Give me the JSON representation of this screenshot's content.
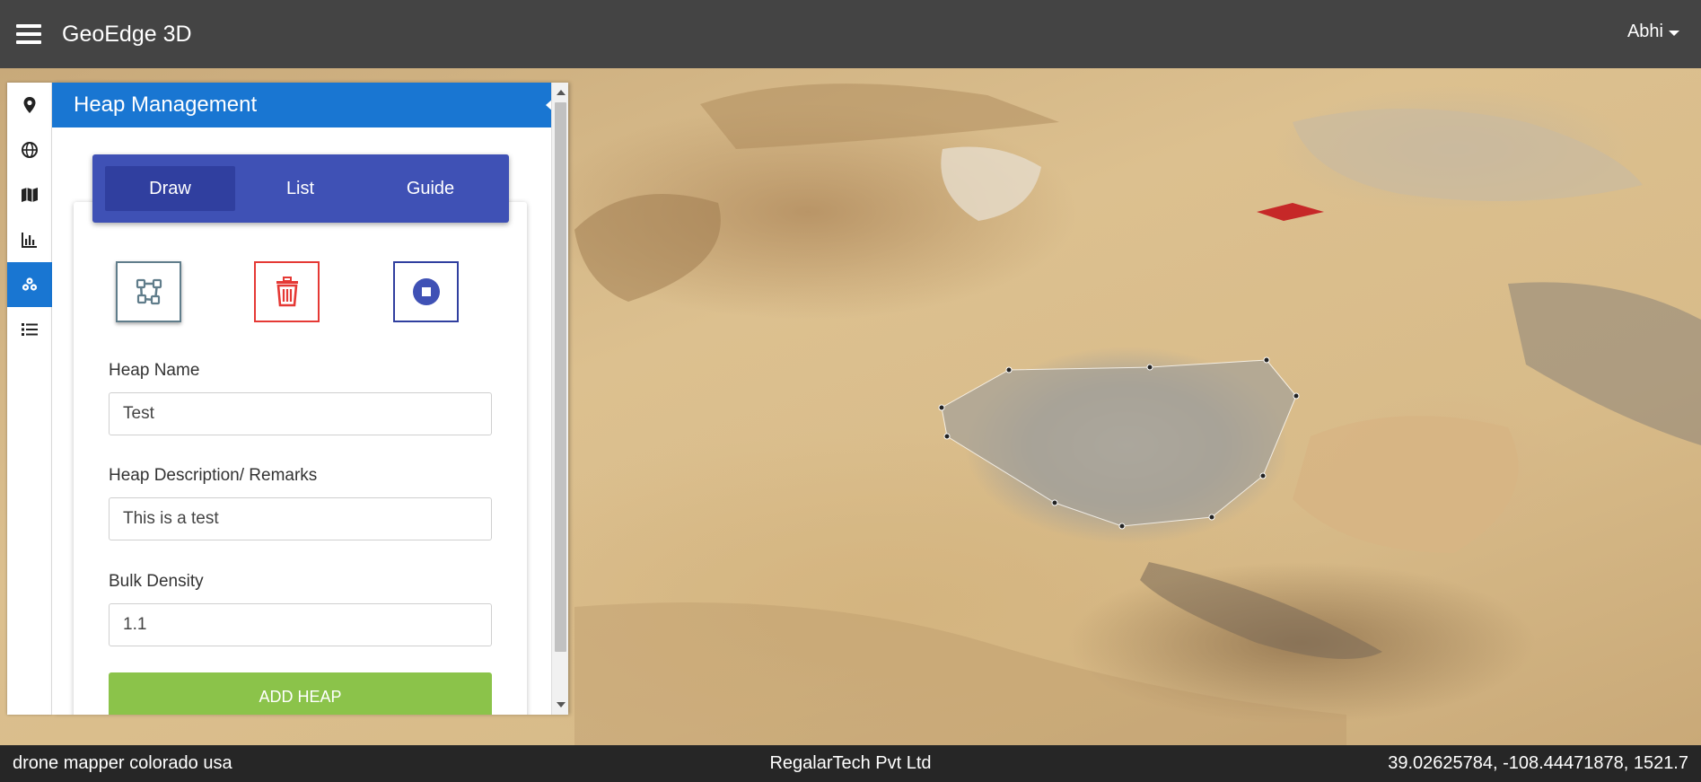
{
  "app": {
    "title": "GeoEdge 3D"
  },
  "user": {
    "name": "Abhi"
  },
  "panel": {
    "title": "Heap Management",
    "tabs": [
      {
        "label": "Draw",
        "active": true
      },
      {
        "label": "List",
        "active": false
      },
      {
        "label": "Guide",
        "active": false
      }
    ],
    "tools": [
      {
        "icon": "polygon-draw-icon"
      },
      {
        "icon": "trash-icon"
      },
      {
        "icon": "stop-circle-icon"
      }
    ],
    "fields": {
      "heap_name": {
        "label": "Heap Name",
        "value": "Test"
      },
      "heap_description": {
        "label": "Heap Description/ Remarks",
        "value": "This is a test"
      },
      "bulk_density": {
        "label": "Bulk Density",
        "value": "1.1"
      }
    },
    "add_button": "ADD HEAP"
  },
  "rail": {
    "items": [
      {
        "icon": "map-marker-icon",
        "active": false
      },
      {
        "icon": "globe-icon",
        "active": false
      },
      {
        "icon": "map-icon",
        "active": false
      },
      {
        "icon": "bar-chart-icon",
        "active": false
      },
      {
        "icon": "heaps-icon",
        "active": true
      },
      {
        "icon": "list-icon",
        "active": false
      }
    ]
  },
  "footer": {
    "left": "drone mapper colorado usa",
    "center": "RegalarTech Pvt Ltd",
    "right": "39.02625784, -108.44471878, 1521.7"
  },
  "colors": {
    "navbar": "#444444",
    "primary": "#1976d2",
    "tabbar": "#3f51b5",
    "tab_active": "#303f9f",
    "add_button": "#8bc34a",
    "delete": "#e53935",
    "footer": "#262626"
  }
}
